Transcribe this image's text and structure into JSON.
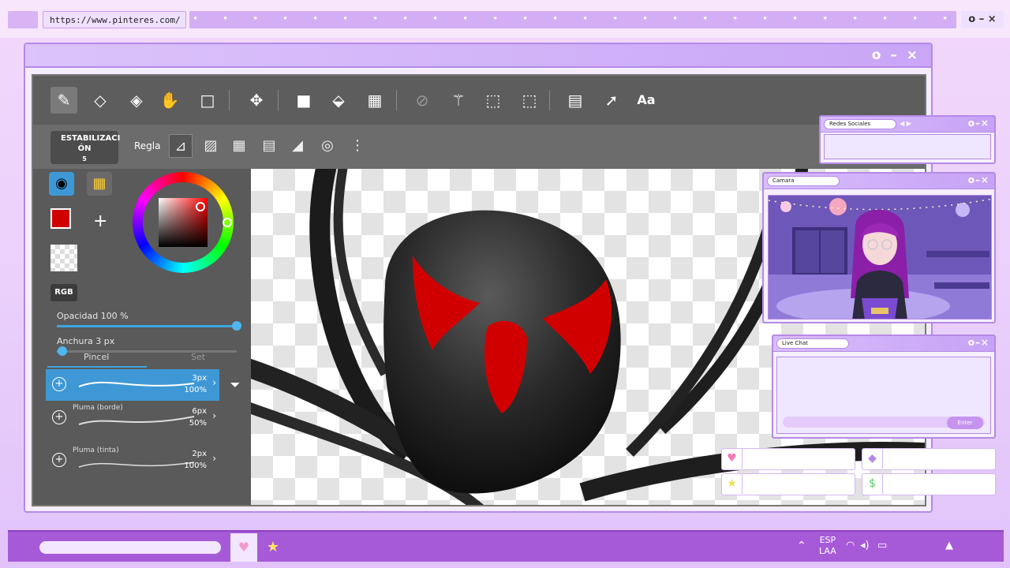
{
  "browser": {
    "url": "https://www.pinteres.com/",
    "window_controls": "o – ×"
  },
  "main_window": {
    "controls": "o – ×"
  },
  "app": {
    "toolbar_icons": [
      "pen-icon",
      "eraser-icon",
      "smudge-eraser-icon",
      "hand-icon",
      "rect-select-icon",
      "move-icon",
      "fill-rect-icon",
      "bucket-icon",
      "gradient-icon",
      "lasso-icon",
      "magic-wand-icon",
      "select-pen-icon",
      "select-eraser-icon",
      "layer-icon",
      "pointer-icon"
    ],
    "text_tool_label": "Aa",
    "stabilizer_label": "ESTABILIZACI ÓN",
    "stabilizer_value": "5",
    "ruler_label": "Regla",
    "more_label": "⋮",
    "color_mode_label": "RGB",
    "opacity_label": "Opacidad 100 %",
    "opacity_value": 1.0,
    "width_label": "Anchura 3 px",
    "width_value": 0.03,
    "brush_tab_label": "Pincel",
    "set_tab_label": "Set",
    "brushes": [
      {
        "name": "",
        "size": "3px",
        "opacity": "100%"
      },
      {
        "name": "Pluma (borde)",
        "size": "6px",
        "opacity": "50%"
      },
      {
        "name": "Pluma (tinta)",
        "size": "2px",
        "opacity": "100%"
      }
    ],
    "current_color": "#d00000"
  },
  "panels": {
    "social": {
      "title": "Redes Sociales"
    },
    "camera": {
      "title": "Camara"
    },
    "chat": {
      "title": "Live Chat",
      "enter_label": "Enter"
    }
  },
  "taskbar": {
    "lang_top": "ESP",
    "lang_bottom": "LAA"
  },
  "colors": {
    "accent": "#a65ad8",
    "panel_border": "#b48ae6"
  }
}
